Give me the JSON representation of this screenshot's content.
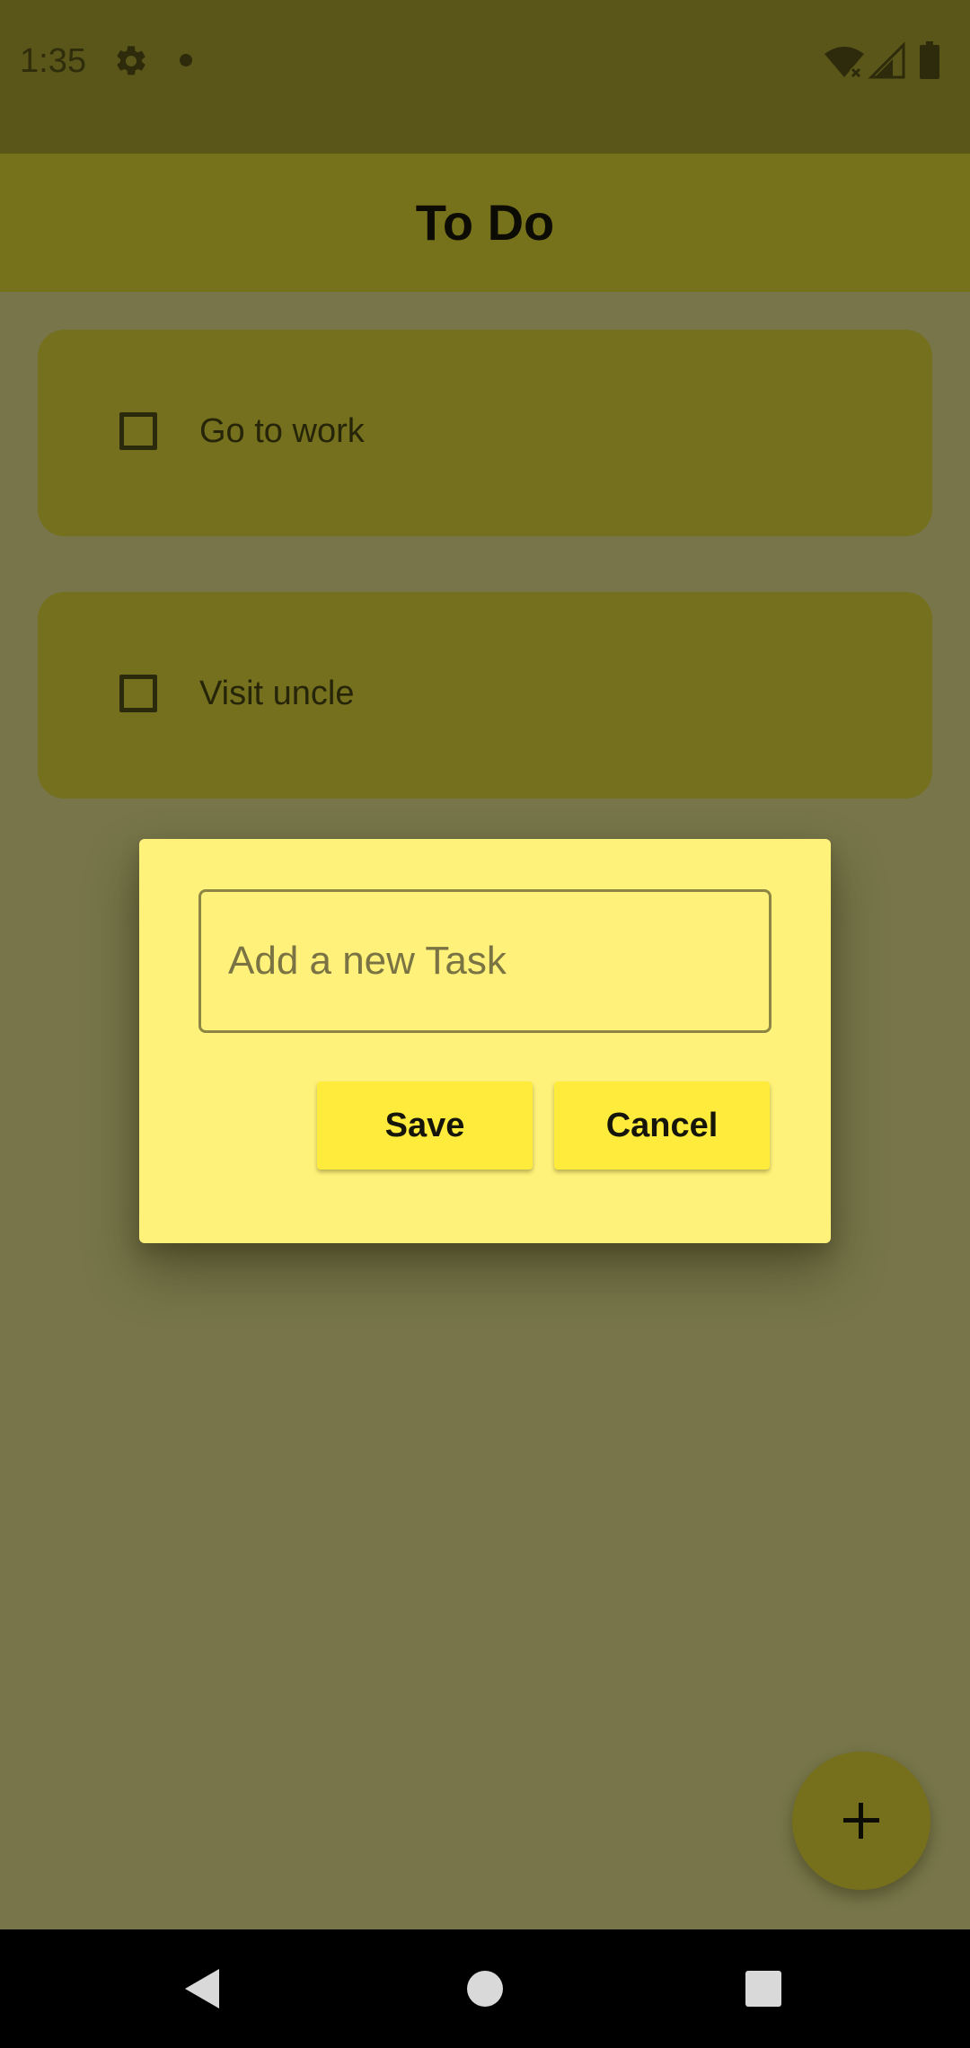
{
  "status_bar": {
    "time": "1:35",
    "icons": [
      "gear-icon",
      "notification-dot-icon",
      "wifi-off-icon",
      "signal-icon",
      "battery-icon"
    ]
  },
  "app_bar": {
    "title": "To Do"
  },
  "tasks": [
    {
      "label": "Go to work",
      "checked": false
    },
    {
      "label": "Visit uncle",
      "checked": false
    }
  ],
  "dialog": {
    "input_placeholder": "Add a new Task",
    "input_value": "",
    "save_label": "Save",
    "cancel_label": "Cancel"
  },
  "fab": {
    "icon": "plus-icon"
  },
  "nav_bar": {
    "icons": [
      "back-icon",
      "home-icon",
      "recents-icon"
    ]
  },
  "colors": {
    "scrim": "#777549",
    "app_bar": "#76711b",
    "card": "#75701d",
    "dialog": "#fff27a",
    "button": "#ffeb3b"
  }
}
